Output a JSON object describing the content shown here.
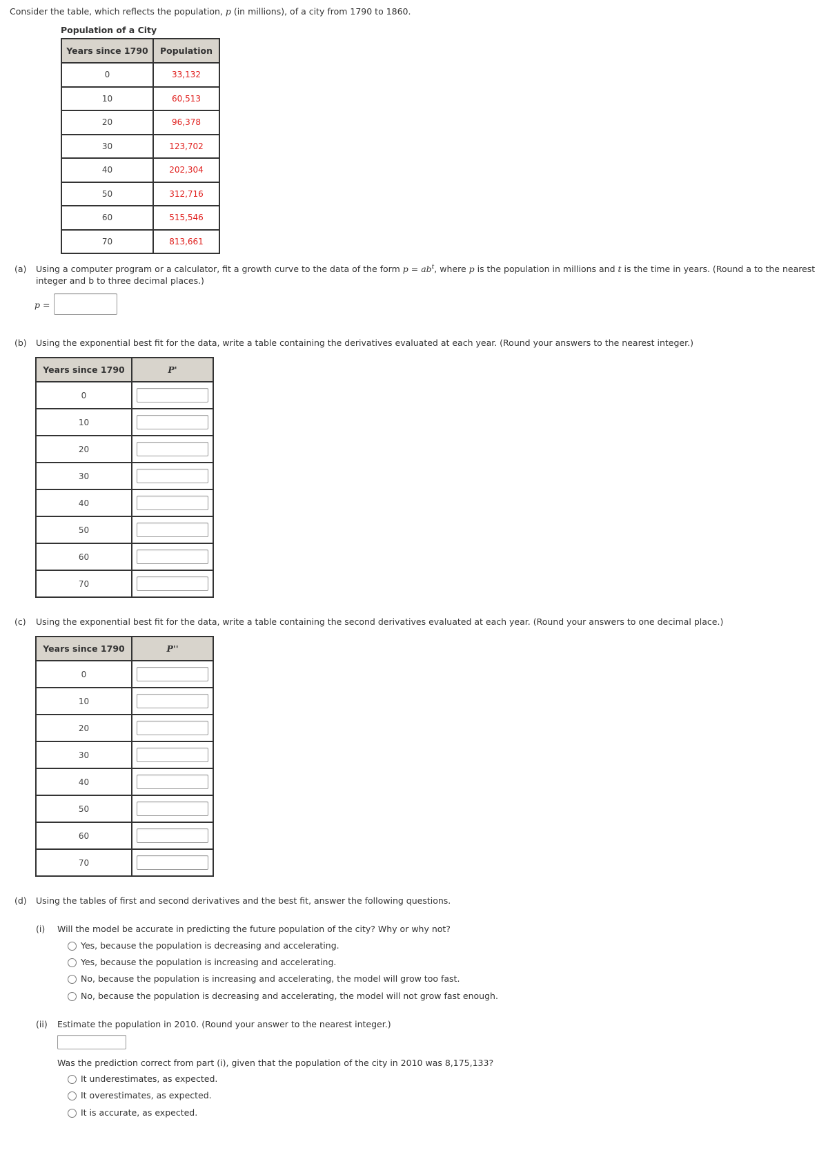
{
  "intro": {
    "prefix": "Consider the table, which reflects the population, ",
    "var": "p",
    "suffix": " (in millions), of a city from 1790 to 1860."
  },
  "population_table": {
    "caption": "Population of a City",
    "headers": [
      "Years since 1790",
      "Population"
    ],
    "rows": [
      {
        "years": "0",
        "population": "33,132"
      },
      {
        "years": "10",
        "population": "60,513"
      },
      {
        "years": "20",
        "population": "96,378"
      },
      {
        "years": "30",
        "population": "123,702"
      },
      {
        "years": "40",
        "population": "202,304"
      },
      {
        "years": "50",
        "population": "312,716"
      },
      {
        "years": "60",
        "population": "515,546"
      },
      {
        "years": "70",
        "population": "813,661"
      }
    ]
  },
  "part_a": {
    "label": "(a)",
    "text1": "Using a computer program or a calculator, fit a growth curve to the data of the form ",
    "formula_lhs": "p",
    "formula_eq": " = ",
    "formula_base": "ab",
    "formula_exp": "t",
    "text2": ", where ",
    "p_var": "p",
    "text3": " is the population in millions and ",
    "t_var": "t",
    "text4": " is the time in years. (Round a to the nearest",
    "line2": "integer and b to three decimal places.)",
    "answer_label_var": "p",
    "answer_label_eq": " =",
    "answer_value": ""
  },
  "part_b": {
    "label": "(b)",
    "text": "Using the exponential best fit for the data, write a table containing the derivatives evaluated at each year. (Round your answers to the nearest integer.)",
    "headers": [
      "Years since 1790",
      "P'"
    ],
    "rows": [
      {
        "years": "0",
        "value": ""
      },
      {
        "years": "10",
        "value": ""
      },
      {
        "years": "20",
        "value": ""
      },
      {
        "years": "30",
        "value": ""
      },
      {
        "years": "40",
        "value": ""
      },
      {
        "years": "50",
        "value": ""
      },
      {
        "years": "60",
        "value": ""
      },
      {
        "years": "70",
        "value": ""
      }
    ]
  },
  "part_c": {
    "label": "(c)",
    "text": "Using the exponential best fit for the data, write a table containing the second derivatives evaluated at each year. (Round your answers to one decimal place.)",
    "headers": [
      "Years since 1790",
      "P''"
    ],
    "rows": [
      {
        "years": "0",
        "value": ""
      },
      {
        "years": "10",
        "value": ""
      },
      {
        "years": "20",
        "value": ""
      },
      {
        "years": "30",
        "value": ""
      },
      {
        "years": "40",
        "value": ""
      },
      {
        "years": "50",
        "value": ""
      },
      {
        "years": "60",
        "value": ""
      },
      {
        "years": "70",
        "value": ""
      }
    ]
  },
  "part_d": {
    "label": "(d)",
    "text": "Using the tables of first and second derivatives and the best fit, answer the following questions.",
    "i": {
      "label": "(i)",
      "question": "Will the model be accurate in predicting the future population of the city? Why or why not?",
      "options": [
        "Yes, because the population is decreasing and accelerating.",
        "Yes, because the population is increasing and accelerating.",
        "No, because the population is increasing and accelerating, the model will grow too fast.",
        "No, because the population is decreasing and accelerating, the model will not grow fast enough."
      ],
      "selected": null
    },
    "ii": {
      "label": "(ii)",
      "question": "Estimate the population in 2010. (Round your answer to the nearest integer.)",
      "answer_value": "",
      "followup": "Was the prediction correct from part (i), given that the population of the city in 2010 was 8,175,133?",
      "options": [
        "It underestimates, as expected.",
        "It overestimates, as expected.",
        "It is accurate, as expected."
      ],
      "selected": null
    }
  }
}
